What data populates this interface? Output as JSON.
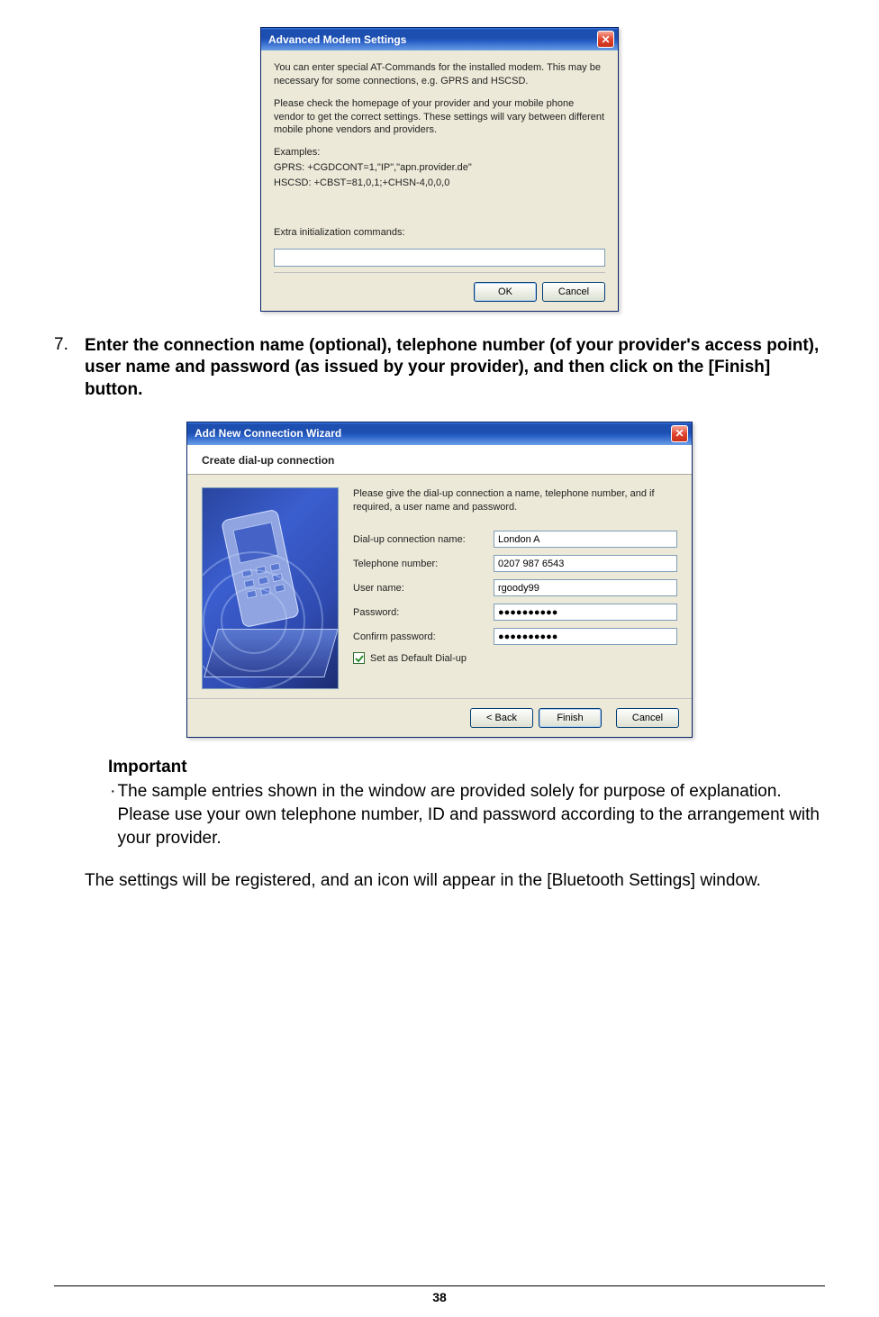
{
  "dialog1": {
    "title": "Advanced Modem Settings",
    "para1": "You can enter special AT-Commands for the installed modem. This may be necessary for some connections, e.g. GPRS and HSCSD.",
    "para2": "Please check the homepage of your provider and your mobile phone vendor to get the correct settings. These settings will vary between different mobile phone vendors and providers.",
    "examples_label": "Examples:",
    "example1": "GPRS: +CGDCONT=1,\"IP\",\"apn.provider.de\"",
    "example2": "HSCSD: +CBST=81,0,1;+CHSN-4,0,0,0",
    "extra_label": "Extra initialization commands:",
    "extra_value": "",
    "ok": "OK",
    "cancel": "Cancel"
  },
  "step": {
    "num": "7.",
    "text": "Enter the connection name (optional), telephone number (of your provider's access point), user name and password (as issued by your provider), and then click on the [Finish] button."
  },
  "dialog2": {
    "title": "Add New Connection Wizard",
    "subtitle": "Create dial-up connection",
    "intro": "Please give the dial-up connection a name, telephone number, and if required, a user name and password.",
    "fields": {
      "conn_label": "Dial-up connection name:",
      "conn_value": "London A",
      "tel_label": "Telephone number:",
      "tel_value": "0207 987 6543",
      "user_label": "User name:",
      "user_value": "rgoody99",
      "pass_label": "Password:",
      "pass_value": "●●●●●●●●●●",
      "conf_label": "Confirm password:",
      "conf_value": "●●●●●●●●●●",
      "default_label": "Set as Default Dial-up"
    },
    "buttons": {
      "back": "< Back",
      "finish": "Finish",
      "cancel": "Cancel"
    }
  },
  "important": {
    "heading": "Important",
    "text": "The sample entries shown in the window are provided solely for purpose of explanation. Please use your own telephone number, ID and password according to the arrangement with your provider."
  },
  "closing": "The settings will be registered, and an icon will appear in the [Bluetooth Settings] window.",
  "page_number": "38"
}
